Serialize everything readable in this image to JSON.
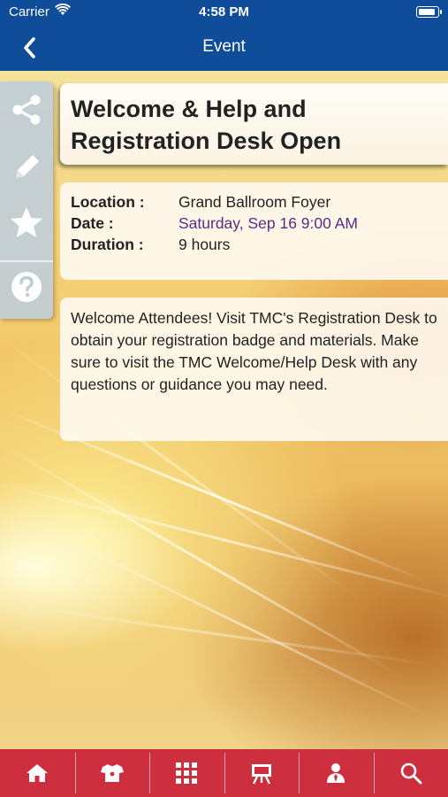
{
  "status_bar": {
    "carrier": "Carrier",
    "time": "4:58 PM"
  },
  "nav": {
    "title": "Event",
    "back_icon": "chevron-left-icon"
  },
  "side_actions": [
    {
      "name": "share",
      "icon": "share-icon"
    },
    {
      "name": "edit",
      "icon": "pencil-icon"
    },
    {
      "name": "favorite",
      "icon": "star-icon"
    },
    {
      "name": "help",
      "icon": "question-icon"
    }
  ],
  "event": {
    "title": "Welcome & Help and Registration Desk Open",
    "location_label": "Location :",
    "location": "Grand Ballroom Foyer",
    "date_label": "Date :",
    "date": "Saturday, Sep 16 9:00 AM",
    "duration_label": "Duration :",
    "duration": "9 hours",
    "description": "Welcome Attendees! Visit TMC's Registration Desk to obtain your registration badge and materials. Make sure to visit the TMC Welcome/Help Desk with any questions or guidance you may need."
  },
  "colors": {
    "header": "#0f4c9a",
    "tab_bar": "#cd2f3e",
    "date_text": "#5a2a86",
    "side_panel": "#becdd c"
  },
  "tab_bar": [
    {
      "name": "home",
      "icon": "home-icon"
    },
    {
      "name": "exhibitors",
      "icon": "shirt-icon"
    },
    {
      "name": "grid",
      "icon": "grid-icon"
    },
    {
      "name": "presentations",
      "icon": "easel-icon"
    },
    {
      "name": "attendees",
      "icon": "person-icon"
    },
    {
      "name": "search",
      "icon": "search-icon"
    }
  ]
}
